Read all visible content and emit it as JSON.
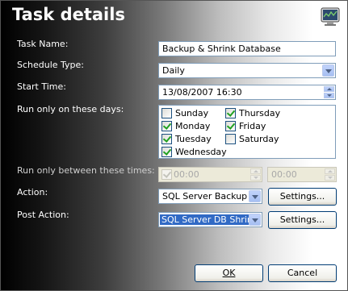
{
  "dialog": {
    "title": "Task details",
    "icon": "monitor-icon"
  },
  "fields": {
    "task_name_label": "Task Name:",
    "task_name_value": "Backup & Shrink Database",
    "schedule_type_label": "Schedule Type:",
    "schedule_type_value": "Daily",
    "start_time_label": "Start Time:",
    "start_time_value": "13/08/2007 16:30",
    "run_days_label": "Run only on these days:",
    "run_between_label": "Run only between these times:",
    "time_from_value": "00:00",
    "time_to_value": "00:00",
    "action_label": "Action:",
    "action_value": "SQL Server Backup",
    "post_action_label": "Post Action:",
    "post_action_value": "SQL Server DB Shrink"
  },
  "days": {
    "sunday": {
      "label": "Sunday",
      "checked": false
    },
    "monday": {
      "label": "Monday",
      "checked": true
    },
    "tuesday": {
      "label": "Tuesday",
      "checked": true
    },
    "wednesday": {
      "label": "Wednesday",
      "checked": true
    },
    "thursday": {
      "label": "Thursday",
      "checked": true
    },
    "friday": {
      "label": "Friday",
      "checked": true
    },
    "saturday": {
      "label": "Saturday",
      "checked": false
    }
  },
  "buttons": {
    "settings_label": "Settings...",
    "ok_label": "OK",
    "cancel_label": "Cancel"
  },
  "colors": {
    "accent": "#316ac5",
    "checkmark": "#21a121",
    "border": "#7f9db9"
  }
}
